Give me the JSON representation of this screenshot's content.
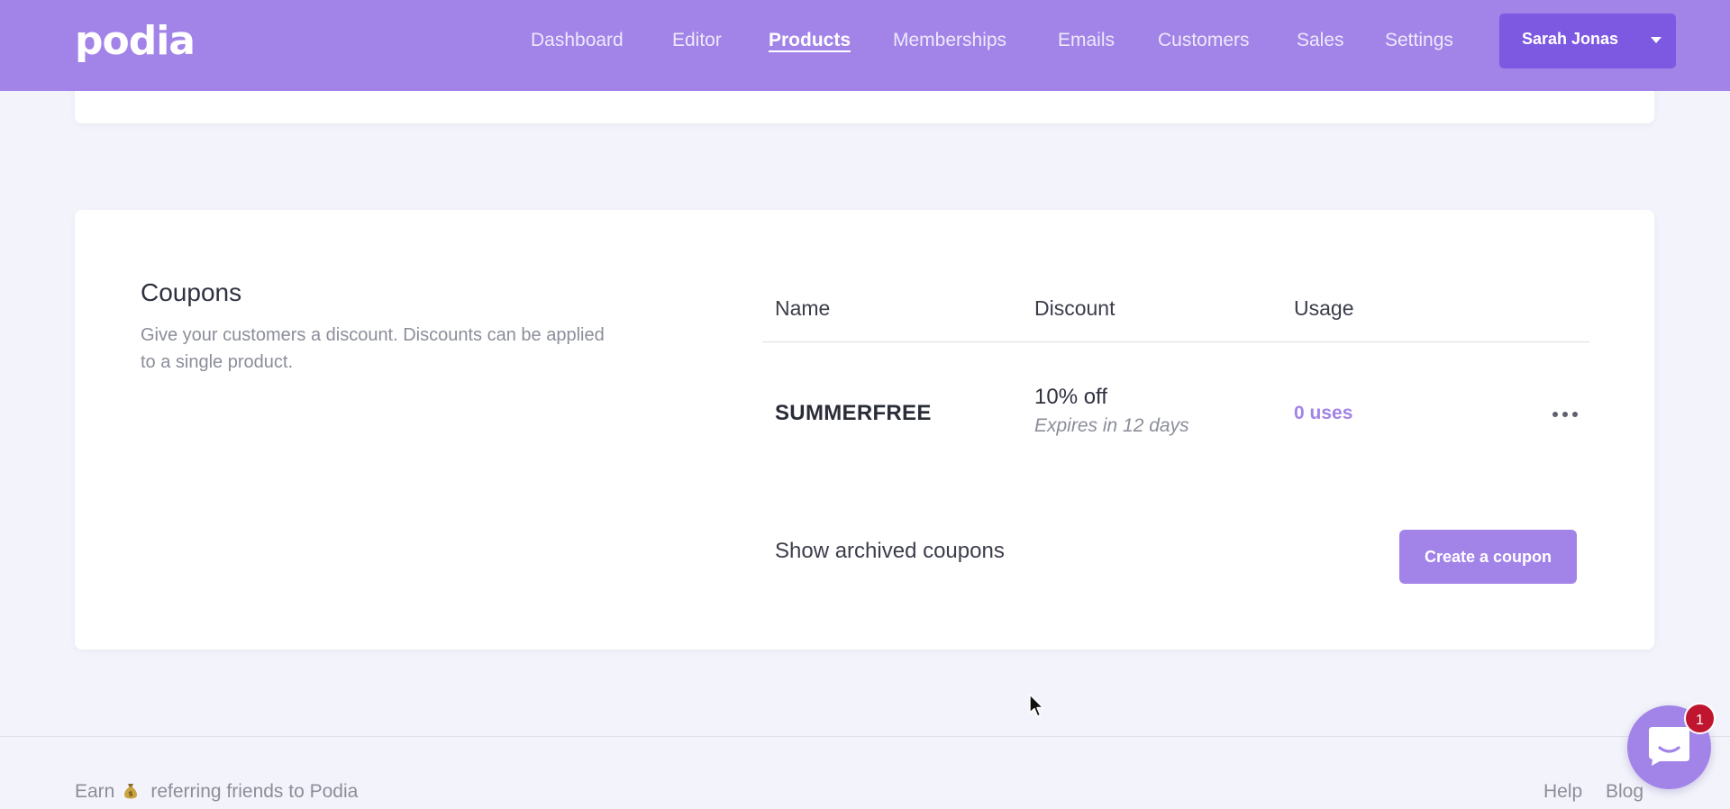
{
  "app": {
    "logo_text": "podia",
    "accent_color": "#a283e8",
    "button_dark_color": "#7c59e0"
  },
  "nav": {
    "items": [
      {
        "label": "Dashboard",
        "active": false
      },
      {
        "label": "Editor",
        "active": false
      },
      {
        "label": "Products",
        "active": true
      },
      {
        "label": "Memberships",
        "active": false
      },
      {
        "label": "Emails",
        "active": false
      },
      {
        "label": "Customers",
        "active": false
      },
      {
        "label": "Sales",
        "active": false
      },
      {
        "label": "Settings",
        "active": false
      }
    ],
    "user_name": "Sarah Jonas"
  },
  "coupons": {
    "title": "Coupons",
    "description": "Give your customers a discount. Discounts can be applied to a single product.",
    "columns": [
      "Name",
      "Discount",
      "Usage"
    ],
    "rows": [
      {
        "name": "SUMMERFREE",
        "discount": "10% off",
        "expiry": "Expires in 12 days",
        "usage": "0 uses",
        "more_icon": "more-horizontal-icon"
      }
    ],
    "show_archived_label": "Show archived coupons",
    "create_label": "Create a coupon"
  },
  "footer": {
    "earn_prefix": "Earn",
    "earn_icon": "money-bag-icon",
    "earn_suffix": "referring friends to Podia",
    "links": [
      "Help",
      "Blog"
    ]
  },
  "chat": {
    "icon": "chat-icon",
    "unread_count": "1"
  }
}
